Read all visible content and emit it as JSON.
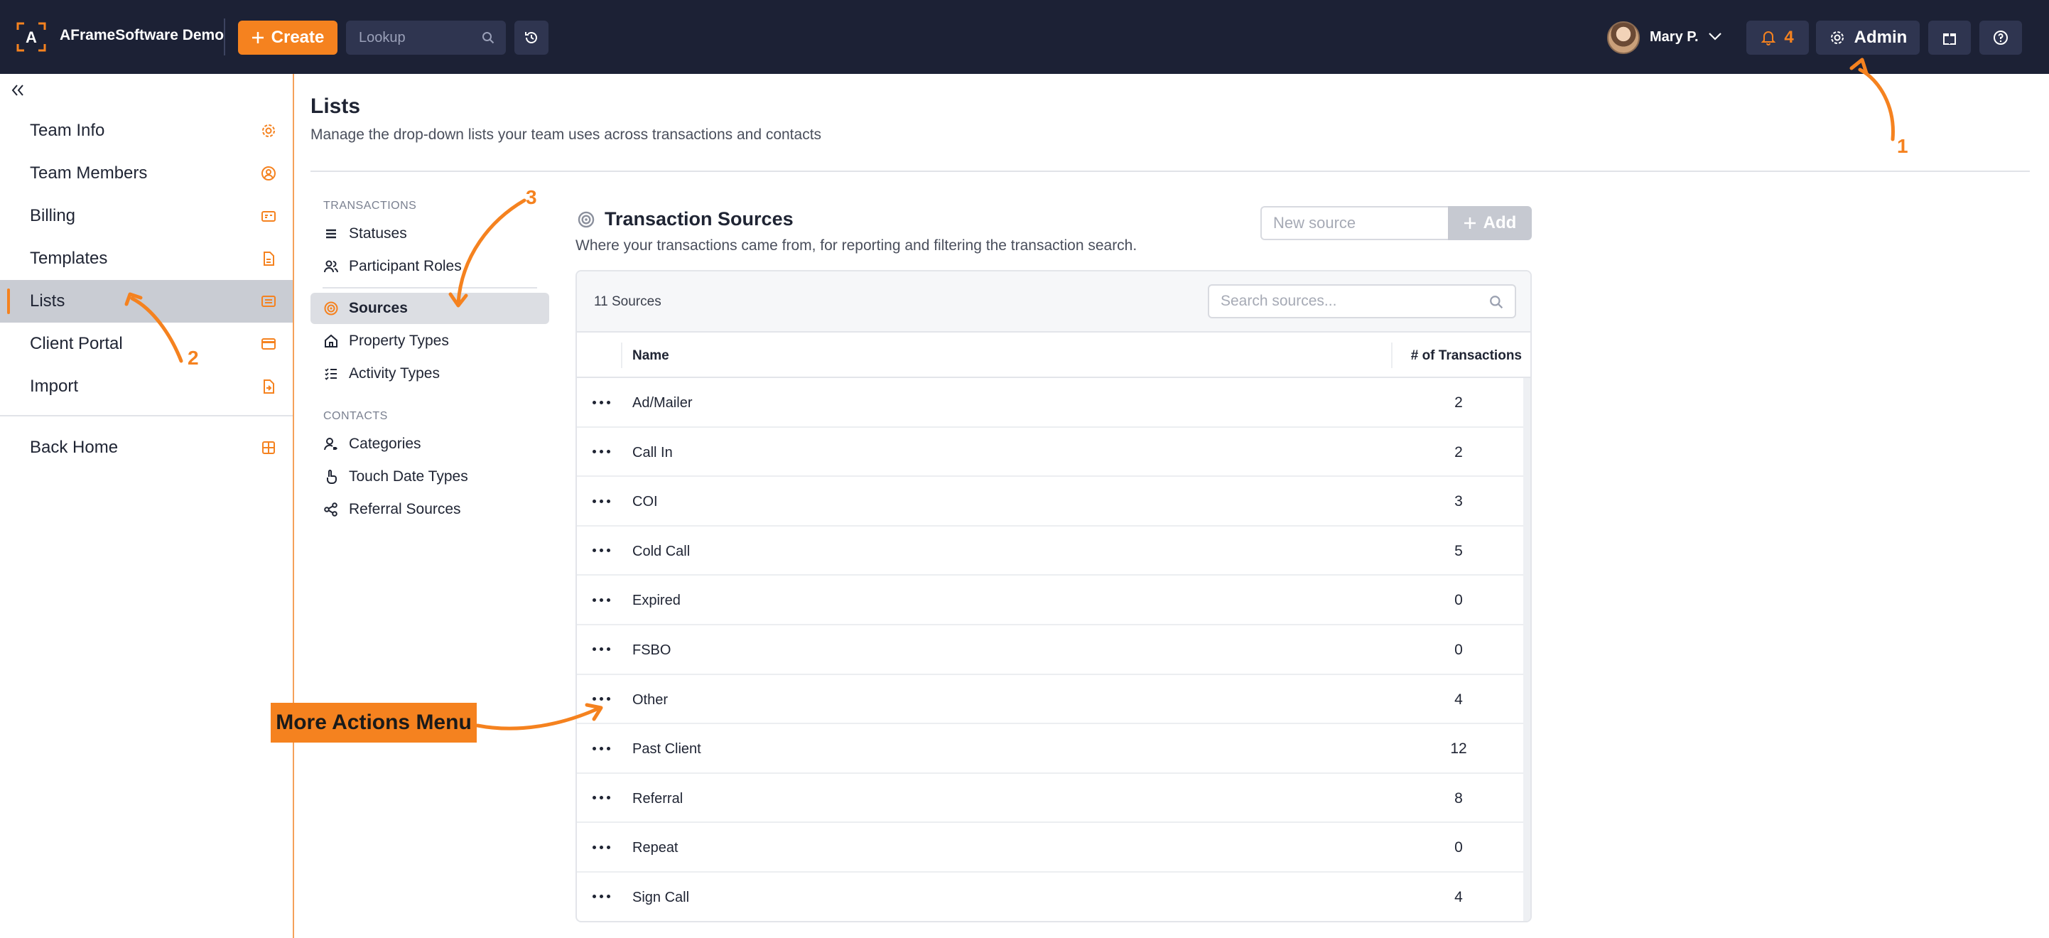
{
  "topbar": {
    "brand": "AFrameSoftware Demo",
    "create_label": "Create",
    "lookup_placeholder": "Lookup",
    "user_name": "Mary P.",
    "notification_count": "4",
    "admin_label": "Admin"
  },
  "sidebar": {
    "items": [
      {
        "label": "Team Info",
        "icon": "gear-icon"
      },
      {
        "label": "Team Members",
        "icon": "user-circle-icon"
      },
      {
        "label": "Billing",
        "icon": "billing-icon"
      },
      {
        "label": "Templates",
        "icon": "document-icon"
      },
      {
        "label": "Lists",
        "icon": "list-icon",
        "active": true
      },
      {
        "label": "Client Portal",
        "icon": "portal-card-icon"
      },
      {
        "label": "Import",
        "icon": "import-icon"
      }
    ],
    "back_home": "Back Home"
  },
  "page": {
    "title": "Lists",
    "subtitle": "Manage the drop-down lists your team uses across transactions and contacts"
  },
  "subnav": {
    "transactions_heading": "TRANSACTIONS",
    "transactions": [
      {
        "label": "Statuses",
        "icon": "stack-icon"
      },
      {
        "label": "Participant Roles",
        "icon": "users-icon"
      },
      {
        "label": "Sources",
        "icon": "target-icon",
        "active": true
      },
      {
        "label": "Property Types",
        "icon": "home-icon"
      },
      {
        "label": "Activity Types",
        "icon": "checklist-icon"
      }
    ],
    "contacts_heading": "CONTACTS",
    "contacts": [
      {
        "label": "Categories",
        "icon": "user-tag-icon"
      },
      {
        "label": "Touch Date Types",
        "icon": "hand-pointer-icon"
      },
      {
        "label": "Referral Sources",
        "icon": "share-nodes-icon"
      }
    ]
  },
  "content": {
    "title": "Transaction Sources",
    "subtitle": "Where your transactions came from, for reporting and filtering the transaction search.",
    "new_source_placeholder": "New source",
    "add_label": "Add",
    "count_label": "11 Sources",
    "search_placeholder": "Search sources...",
    "columns": {
      "name": "Name",
      "count": "# of Transactions"
    },
    "rows": [
      {
        "name": "Ad/Mailer",
        "count": "2"
      },
      {
        "name": "Call In",
        "count": "2"
      },
      {
        "name": "COI",
        "count": "3"
      },
      {
        "name": "Cold Call",
        "count": "5"
      },
      {
        "name": "Expired",
        "count": "0"
      },
      {
        "name": "FSBO",
        "count": "0"
      },
      {
        "name": "Other",
        "count": "4"
      },
      {
        "name": "Past Client",
        "count": "12"
      },
      {
        "name": "Referral",
        "count": "8"
      },
      {
        "name": "Repeat",
        "count": "0"
      },
      {
        "name": "Sign Call",
        "count": "4"
      }
    ]
  },
  "annotations": {
    "marker_1": "1",
    "marker_2": "2",
    "marker_3": "3",
    "callout": "More Actions Menu"
  },
  "colors": {
    "accent": "#f5821f",
    "topbar": "#1c2135",
    "button_dark": "#2f3550",
    "active_nav": "#c9ccd3"
  }
}
